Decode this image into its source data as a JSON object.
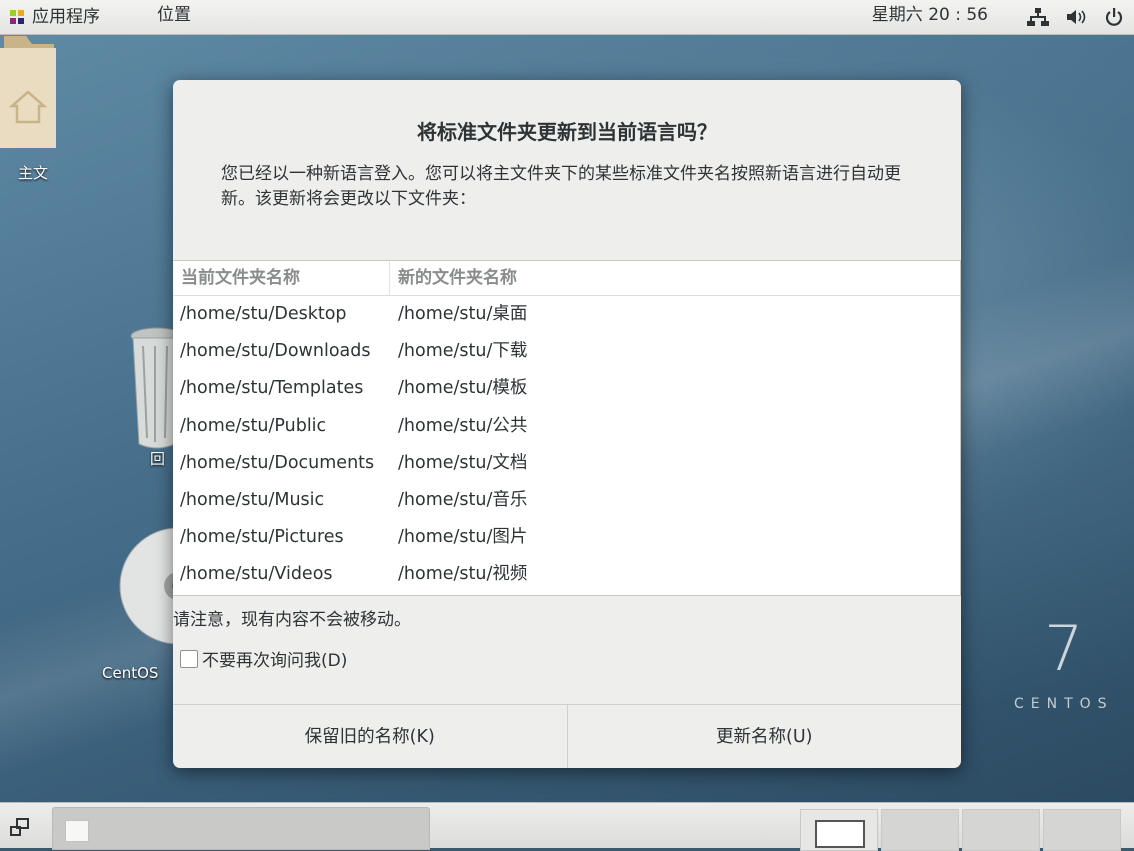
{
  "topbar": {
    "apps_label": "应用程序",
    "places_label": "位置",
    "clock": "星期六 20 : 56",
    "tray_icons": [
      "network-icon",
      "volume-icon",
      "power-icon"
    ]
  },
  "desktop": {
    "folder_label": "主文",
    "trash_label": "回",
    "disc_label": "CentOS",
    "brand_number": "7",
    "brand_word": "CENTOS"
  },
  "dialog": {
    "title": "将标准文件夹更新到当前语言吗？",
    "message": "您已经以一种新语言登入。您可以将主文件夹下的某些标准文件夹名按照新语言进行自动更新。该更新将会更改以下文件夹：",
    "columns": [
      "当前文件夹名称",
      "新的文件夹名称"
    ],
    "rows": [
      [
        "/home/stu/Desktop",
        "/home/stu/桌面"
      ],
      [
        "/home/stu/Downloads",
        "/home/stu/下载"
      ],
      [
        "/home/stu/Templates",
        "/home/stu/模板"
      ],
      [
        "/home/stu/Public",
        "/home/stu/公共"
      ],
      [
        "/home/stu/Documents",
        "/home/stu/文档"
      ],
      [
        "/home/stu/Music",
        "/home/stu/音乐"
      ],
      [
        "/home/stu/Pictures",
        "/home/stu/图片"
      ],
      [
        "/home/stu/Videos",
        "/home/stu/视频"
      ]
    ],
    "note": "请注意，现有内容不会被移动。",
    "checkbox_label": "不要再次询问我(D)",
    "checkbox_checked": false,
    "keep_button": "保留旧的名称(K)",
    "update_button": "更新名称(U)"
  },
  "taskbar": {
    "workspaces": 4,
    "active_workspace": 1
  }
}
